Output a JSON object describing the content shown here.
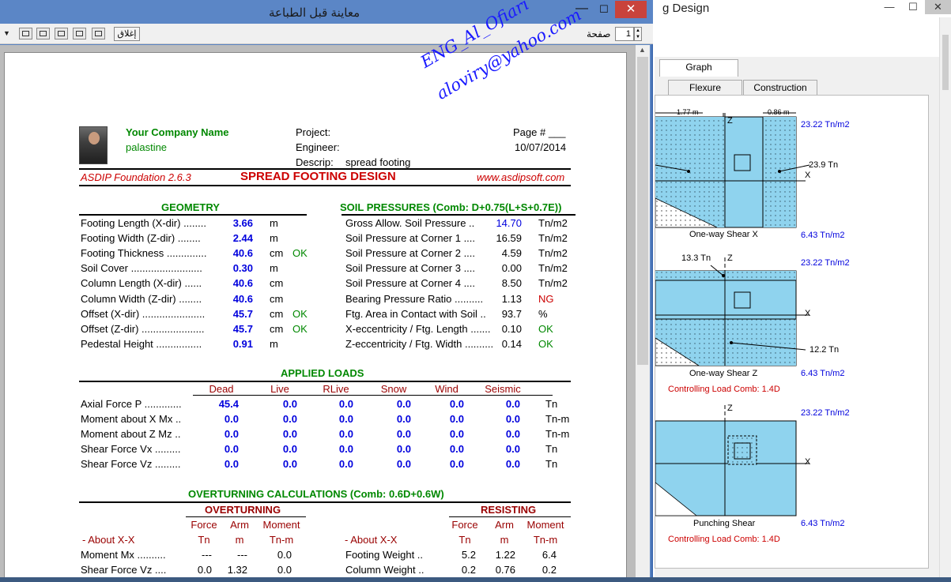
{
  "background_app": {
    "title": "g Design",
    "tabs": [
      "Graph",
      "Flexure",
      "Construction"
    ],
    "graphs": [
      {
        "caption": "One-way Shear X",
        "top_pressure": "23.22 Tn/m2",
        "bottom_pressure": "6.43 Tn/m2",
        "dim_left": "1.77 m",
        "dim_right": "0.86 m",
        "value_label": "23.9 Tn",
        "axis_x": "X",
        "axis_z": "Z"
      },
      {
        "caption": "One-way Shear Z",
        "top_pressure": "23.22 Tn/m2",
        "bottom_pressure": "6.43 Tn/m2",
        "value_top": "13.3 Tn",
        "value_label": "12.2 Tn",
        "axis_x": "X",
        "axis_z": "Z",
        "controlling": "Controlling Load Comb: 1.4D"
      },
      {
        "caption": "Punching Shear",
        "top_pressure": "23.22 Tn/m2",
        "bottom_pressure": "6.43 Tn/m2",
        "axis_x": "X",
        "axis_z": "Z",
        "controlling": "Controlling Load Comb: 1.4D"
      }
    ]
  },
  "preview": {
    "title": "معاينة قبل الطباعة",
    "close_label": "إغلاق",
    "page_label": "صفحة",
    "page_value": "1"
  },
  "report": {
    "company": "Your Company Name",
    "location": "palastine",
    "project_label": "Project:",
    "engineer_label": "Engineer:",
    "descrip_label": "Descrip:",
    "descrip_value": "spread footing",
    "page_num": "Page # ___",
    "date": "10/07/2014",
    "software": "ASDIP Foundation 2.6.3",
    "heading": "SPREAD FOOTING DESIGN",
    "website": "www.asdipsoft.com",
    "watermark_line1": "ENG_Al_Ofiari",
    "watermark_line2": "aloviry@yahoo.com",
    "geometry": {
      "title": "GEOMETRY",
      "rows": [
        {
          "label": "Footing Length (X-dir)  ........",
          "value": "3.66",
          "unit": "m",
          "status": ""
        },
        {
          "label": "Footing Width (Z-dir)  ........",
          "value": "2.44",
          "unit": "m",
          "status": ""
        },
        {
          "label": "Footing Thickness  ..............",
          "value": "40.6",
          "unit": "cm",
          "status": "OK"
        },
        {
          "label": "Soil Cover  .........................",
          "value": "0.30",
          "unit": "m",
          "status": ""
        },
        {
          "label": "Column Length (X-dir)  ......",
          "value": "40.6",
          "unit": "cm",
          "status": ""
        },
        {
          "label": "Column Width (Z-dir)  ........",
          "value": "40.6",
          "unit": "cm",
          "status": ""
        },
        {
          "label": "Offset (X-dir)  ......................",
          "value": "45.7",
          "unit": "cm",
          "status": "OK"
        },
        {
          "label": "Offset (Z-dir)  ......................",
          "value": "45.7",
          "unit": "cm",
          "status": "OK"
        },
        {
          "label": "Pedestal Height  ................",
          "value": "0.91",
          "unit": "m",
          "status": ""
        }
      ]
    },
    "soil": {
      "title": "SOIL PRESSURES  (Comb: D+0.75(L+S+0.7E))",
      "rows": [
        {
          "label": "Gross Allow. Soil Pressure  ..",
          "value": "14.70",
          "unit": "Tn/m2",
          "style": "bl"
        },
        {
          "label": "Soil Pressure at Corner 1  ....",
          "value": "16.59",
          "unit": "Tn/m2",
          "style": ""
        },
        {
          "label": "Soil Pressure at Corner 2  ....",
          "value": "4.59",
          "unit": "Tn/m2",
          "style": ""
        },
        {
          "label": "Soil Pressure at Corner 3  ....",
          "value": "0.00",
          "unit": "Tn/m2",
          "style": ""
        },
        {
          "label": "Soil Pressure at Corner 4  ....",
          "value": "8.50",
          "unit": "Tn/m2",
          "style": ""
        },
        {
          "label": "Bearing Pressure Ratio  ..........",
          "value": "1.13",
          "unit": "NG",
          "style": "ng"
        },
        {
          "label": "Ftg. Area in Contact with Soil  ..",
          "value": "93.7",
          "unit": "%",
          "style": ""
        },
        {
          "label": "X-eccentricity / Ftg. Length  .......",
          "value": "0.10",
          "unit": "OK",
          "style": "ok"
        },
        {
          "label": "Z-eccentricity / Ftg. Width  ..........",
          "value": "0.14",
          "unit": "OK",
          "style": "ok"
        }
      ]
    },
    "loads": {
      "title": "APPLIED LOADS",
      "columns": [
        "Dead",
        "Live",
        "RLive",
        "Snow",
        "Wind",
        "Seismic"
      ],
      "rows": [
        {
          "label": "Axial Force  P  .............",
          "values": [
            "45.4",
            "0.0",
            "0.0",
            "0.0",
            "0.0",
            "0.0"
          ],
          "unit": "Tn"
        },
        {
          "label": "Moment about X  Mx  ..",
          "values": [
            "0.0",
            "0.0",
            "0.0",
            "0.0",
            "0.0",
            "0.0"
          ],
          "unit": "Tn-m"
        },
        {
          "label": "Moment about Z  Mz  ..",
          "values": [
            "0.0",
            "0.0",
            "0.0",
            "0.0",
            "0.0",
            "0.0"
          ],
          "unit": "Tn-m"
        },
        {
          "label": "Shear Force  Vx  .........",
          "values": [
            "0.0",
            "0.0",
            "0.0",
            "0.0",
            "0.0",
            "0.0"
          ],
          "unit": "Tn"
        },
        {
          "label": "Shear Force  Vz  .........",
          "values": [
            "0.0",
            "0.0",
            "0.0",
            "0.0",
            "0.0",
            "0.0"
          ],
          "unit": "Tn"
        }
      ]
    },
    "overturning": {
      "title": "OVERTURNING CALCULATIONS  (Comb: 0.6D+0.6W)",
      "left_title": "OVERTURNING",
      "right_title": "RESISTING",
      "col_heads": [
        "Force",
        "Arm",
        "Moment"
      ],
      "col_units": [
        "Tn",
        "m",
        "Tn-m"
      ],
      "about": "-  About X-X",
      "left_rows": [
        {
          "label": "Moment Mx  ..........",
          "values": [
            "---",
            "---",
            "0.0"
          ]
        },
        {
          "label": "Shear Force Vz  ....",
          "values": [
            "0.0",
            "1.32",
            "0.0"
          ]
        }
      ],
      "right_rows": [
        {
          "label": "Footing Weight  ..",
          "values": [
            "5.2",
            "1.22",
            "6.4"
          ]
        },
        {
          "label": "Column Weight  ..",
          "values": [
            "0.2",
            "0.76",
            "0.2"
          ]
        }
      ]
    }
  }
}
